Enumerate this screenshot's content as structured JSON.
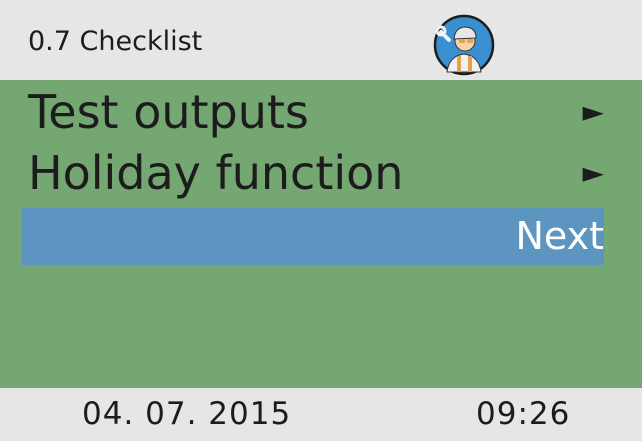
{
  "header": {
    "title": "0.7 Checklist",
    "avatar_icon": "installer-technician-icon"
  },
  "menu": {
    "items": [
      {
        "label": "Test outputs",
        "arrow": "►"
      },
      {
        "label": "Holiday function",
        "arrow": "►"
      }
    ],
    "next_label": "Next"
  },
  "footer": {
    "date": "04. 07. 2015",
    "time": "09:26"
  },
  "colors": {
    "background": "#e6e6e6",
    "menu_background": "#74a771",
    "selection": "#5d95c1",
    "text": "#1c1c1c"
  }
}
